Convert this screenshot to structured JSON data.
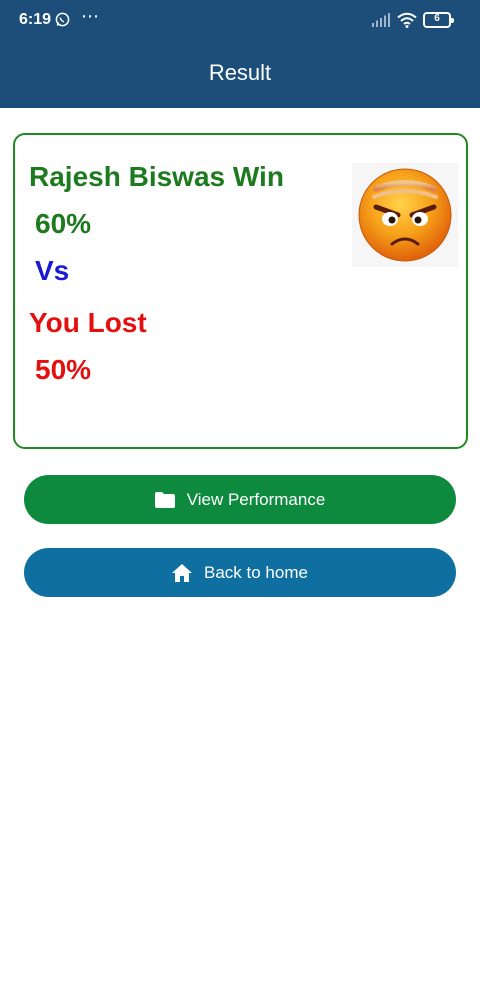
{
  "status_bar": {
    "time": "6:19",
    "dots": "⋯",
    "battery": "6"
  },
  "header": {
    "title": "Result"
  },
  "result": {
    "winner_text": "Rajesh Biswas Win",
    "winner_percent": "60%",
    "vs_text": "Vs",
    "loser_text": "You Lost",
    "loser_percent": "50%",
    "emoji_icon": "angry-face-icon"
  },
  "buttons": {
    "view_performance": "View Performance",
    "back_home": "Back to home"
  },
  "colors": {
    "appbar": "#1d4e79",
    "win_green": "#1e7a1e",
    "vs_blue": "#1a1ad6",
    "lost_red": "#e41010",
    "perf_button": "#0d8a3e",
    "home_button": "#0f6fa1"
  }
}
